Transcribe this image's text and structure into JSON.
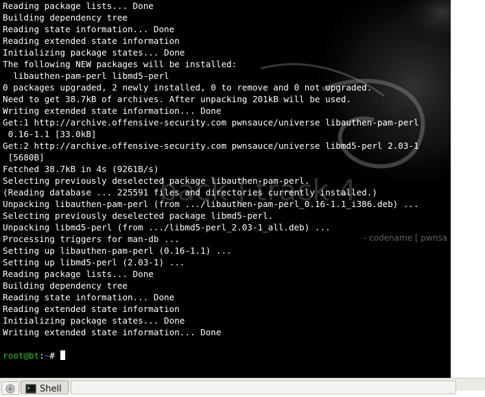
{
  "terminal": {
    "lines": [
      "Reading package lists... Done",
      "Building dependency tree",
      "Reading state information... Done",
      "Reading extended state information",
      "Initializing package states... Done",
      "The following NEW packages will be installed:",
      "  libauthen-pam-perl libmd5-perl",
      "0 packages upgraded, 2 newly installed, 0 to remove and 0 not upgraded.",
      "Need to get 38.7kB of archives. After unpacking 201kB will be used.",
      "Writing extended state information... Done",
      "Get:1 http://archive.offensive-security.com pwnsauce/universe libauthen-pam-perl",
      " 0.16-1.1 [33.0kB]",
      "Get:2 http://archive.offensive-security.com pwnsauce/universe libmd5-perl 2.03-1",
      " [5680B]",
      "Fetched 38.7kB in 4s (9261B/s)",
      "Selecting previously deselected package libauthen-pam-perl.",
      "(Reading database ... 225591 files and directories currently installed.)",
      "Unpacking libauthen-pam-perl (from .../libauthen-pam-perl_0.16-1.1_i386.deb) ...",
      "Selecting previously deselected package libmd5-perl.",
      "Unpacking libmd5-perl (from .../libmd5-perl_2.03-1_all.deb) ...",
      "Processing triggers for man-db ...",
      "Setting up libauthen-pam-perl (0.16-1.1) ...",
      "Setting up libmd5-perl (2.03-1) ...",
      "Reading package lists... Done",
      "Building dependency tree",
      "Reading state information... Done",
      "Reading extended state information",
      "Initializing package states... Done",
      "Writing extended state information... Done"
    ],
    "prompt": {
      "user_host": "root@bt",
      "separator": ":",
      "path": "~",
      "symbol": "# "
    }
  },
  "wallpaper": {
    "brand": "back | track 4",
    "tagline": "- codename [ pwnsa"
  },
  "taskbar": {
    "task_label": "Shell"
  },
  "colors": {
    "terminal_bg": "#000000",
    "terminal_fg": "#ffffff",
    "prompt_user": "#2fbf2f",
    "prompt_path": "#4a7bd6"
  }
}
